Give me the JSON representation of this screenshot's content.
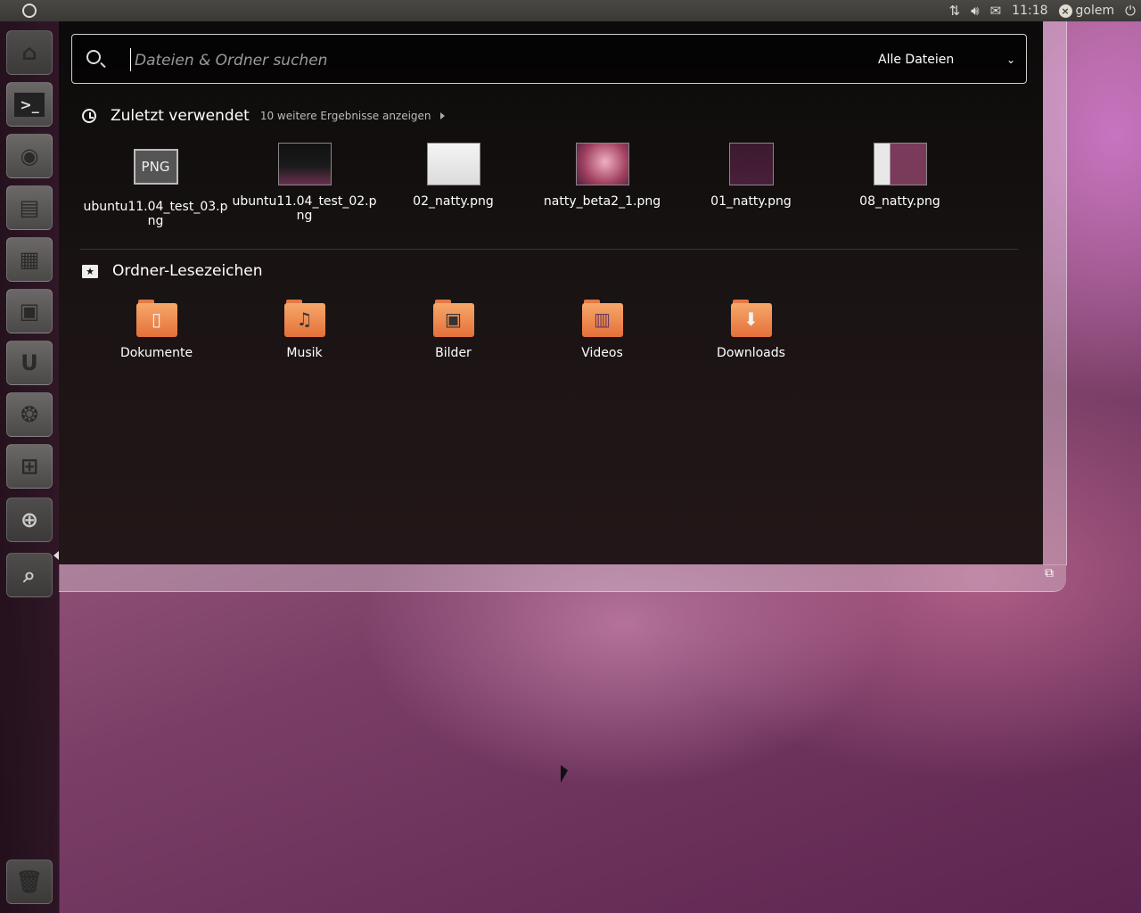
{
  "top_panel": {
    "time": "11:18",
    "user": "golem",
    "icons": [
      "network-icon",
      "volume-icon",
      "mail-icon",
      "power-icon"
    ]
  },
  "launcher": {
    "items": [
      "home-folder",
      "terminal",
      "firefox",
      "libreoffice-writer",
      "libreoffice-calc",
      "libreoffice-impress",
      "ubuntu-one",
      "software-center",
      "workspace-switcher",
      "dash-applications",
      "dash-files",
      "trash"
    ]
  },
  "dash": {
    "search": {
      "placeholder": "Dateien & Ordner suchen",
      "filter": "Alle Dateien"
    },
    "recent": {
      "title": "Zuletzt verwendet",
      "more": "10 weitere Ergebnisse anzeigen",
      "items": [
        {
          "label": "ubuntu11.04_test_03.png",
          "thumb": "PNG"
        },
        {
          "label": "ubuntu11.04_test_02.png"
        },
        {
          "label": "02_natty.png"
        },
        {
          "label": "natty_beta2_1.png"
        },
        {
          "label": "01_natty.png"
        },
        {
          "label": "08_natty.png"
        }
      ]
    },
    "bookmarks": {
      "title": "Ordner-Lesezeichen",
      "items": [
        {
          "label": "Dokumente",
          "icon": "document-icon"
        },
        {
          "label": "Musik",
          "icon": "music-icon"
        },
        {
          "label": "Bilder",
          "icon": "picture-icon"
        },
        {
          "label": "Videos",
          "icon": "film-icon"
        },
        {
          "label": "Downloads",
          "icon": "download-icon"
        }
      ]
    }
  }
}
